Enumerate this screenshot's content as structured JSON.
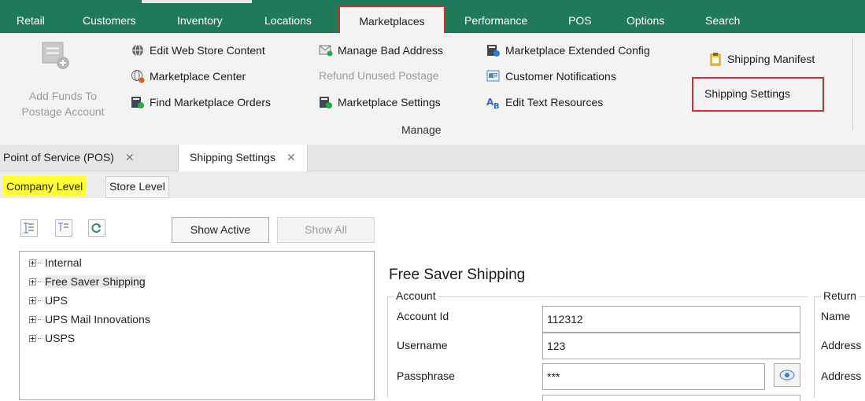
{
  "menu": {
    "items": [
      "Retail",
      "Customers",
      "Inventory",
      "Locations",
      "Marketplaces",
      "Performance",
      "POS",
      "Options",
      "Search"
    ],
    "active": "Marketplaces"
  },
  "ribbon": {
    "add_funds_line1": "Add Funds To",
    "add_funds_line2": "Postage Account",
    "edit_web_store": "Edit Web Store Content",
    "marketplace_center": "Marketplace Center",
    "find_marketplace_orders": "Find Marketplace Orders",
    "manage_bad_address": "Manage Bad Address",
    "refund_unused_postage": "Refund Unused Postage",
    "marketplace_settings": "Marketplace Settings",
    "marketplace_extended_config": "Marketplace Extended Config",
    "customer_notifications": "Customer Notifications",
    "edit_text_resources": "Edit Text Resources",
    "shipping_manifest": "Shipping Manifest",
    "shipping_settings": "Shipping Settings",
    "group_label": "Manage"
  },
  "doc_tabs": [
    {
      "label": "Point of Service (POS)",
      "close": "✕"
    },
    {
      "label": "Shipping Settings",
      "close": "✕"
    }
  ],
  "level_tabs": [
    "Company Level",
    "Store Level"
  ],
  "toolbar": {
    "show_active": "Show Active",
    "show_all": "Show All"
  },
  "tree": [
    "Internal",
    "Free Saver Shipping",
    "UPS",
    "UPS Mail Innovations",
    "USPS"
  ],
  "detail": {
    "title": "Free Saver Shipping",
    "account_group": "Account",
    "account_id_label": "Account Id",
    "account_id_value": "112312",
    "username_label": "Username",
    "username_value": "123",
    "passphrase_label": "Passphrase",
    "passphrase_value": "***",
    "return_group": "Return",
    "return_name_label": "Name",
    "return_address_label_1": "Address",
    "return_address_label_2": "Address"
  },
  "colors": {
    "menubar": "#1f7a5a",
    "highlight_red": "#d12b2b",
    "company_level_highlight": "#ffff33"
  }
}
